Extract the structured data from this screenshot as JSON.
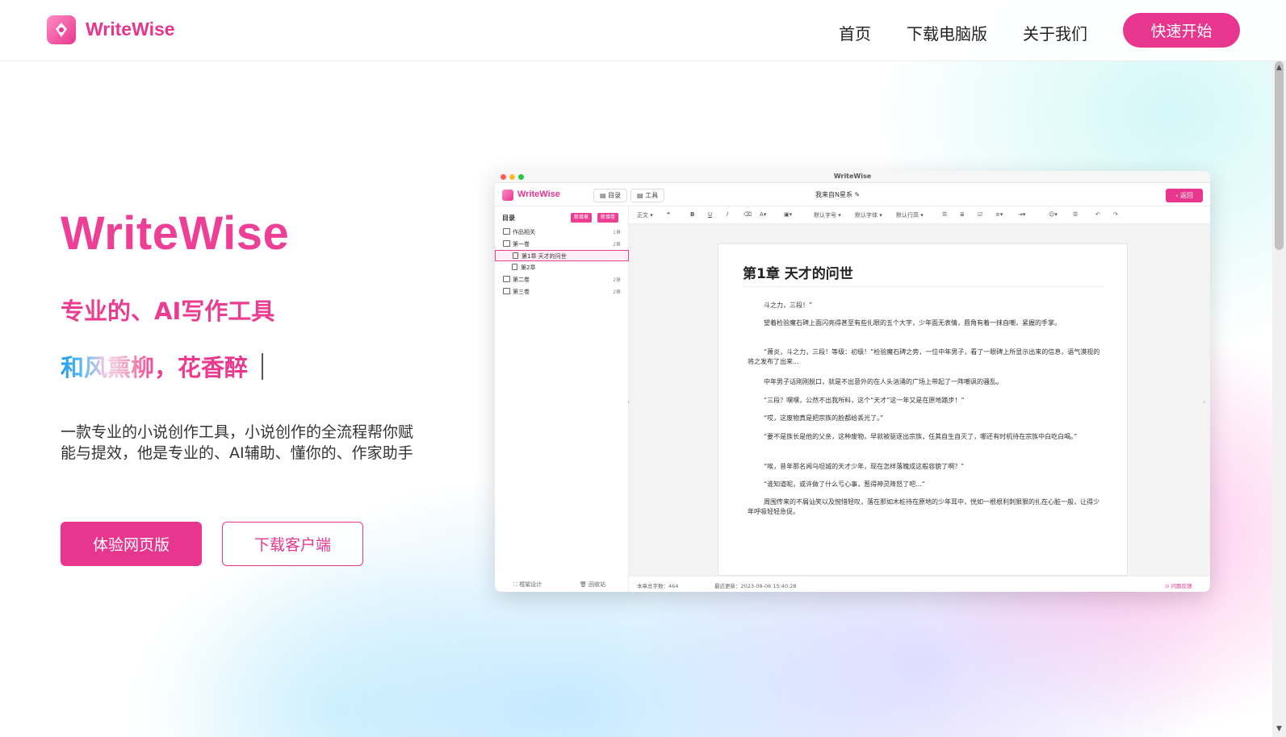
{
  "nav": {
    "brand": "WriteWise",
    "links": [
      "首页",
      "下载电脑版",
      "关于我们"
    ],
    "cta": "快速开始"
  },
  "hero": {
    "title": "WriteWise",
    "subtitle": "专业的、AI写作工具",
    "poem": "和风熏柳，花香醉",
    "description": "一款专业的小说创作工具，小说创作的全流程帮你赋能与提效，他是专业的、AI辅助、懂你的、作家助手",
    "btn_primary": "体验网页版",
    "btn_secondary": "下载客户端"
  },
  "app": {
    "window_title": "WriteWise",
    "brand": "WriteWise",
    "header_buttons": [
      "目录",
      "工具"
    ],
    "doc_name": "我来自N星系",
    "back_label": "返回",
    "sidebar": {
      "heading": "目录",
      "tag_new_chapter": "新增章",
      "tag_new_volume": "新增卷",
      "tree": [
        {
          "label": "作品相关",
          "count": "1章"
        },
        {
          "label": "第一卷",
          "count": "2章"
        },
        {
          "label": "第1章 天才的问世",
          "count": ""
        },
        {
          "label": "第2章",
          "count": ""
        },
        {
          "label": "第二卷",
          "count": "2章"
        },
        {
          "label": "第三卷",
          "count": "2章"
        }
      ],
      "footer_left": "框架设计",
      "footer_right": "回收站"
    },
    "toolbar": {
      "style": "正文",
      "font_size": "默认字号",
      "font_family": "默认字体",
      "line_height": "默认行高"
    },
    "chapter_title": "第1章  天才的问世",
    "paragraphs": [
      "斗之力，三段！”",
      "望着检验魔石碑上面闪亮得甚至有些扎眼的五个大字，少年面无表情，唇角有着一抹自嘲，紧握的手掌。",
      "“萧炎，斗之力，三段！等级：初级！”检验魔石碑之旁，一位中年男子，看了一眼碑上所显示出来的信息，语气漠视的将之发布了出来...",
      "中年男子话刚刚脱口，就是不出意外的在人头汹涌的广场上带起了一阵嘲讽的骚乱。",
      "“三段？嘿嘿，公然不出我所料，这个“天才”这一年又是在原地踏步！”",
      "“哎，这废物真是把宗族的脸都给丢光了。”",
      "“要不是族长是他的父亲，这种废物，早就被驱逐出宗族，任其自生自灭了，哪还有时机待在宗族中白吃白喝。”",
      "“唉，昔年那名闻乌坦城的天才少年，现在怎样落魄成这般容貌了啊？”",
      "“谁知道呢，或许做了什么亏心事，惹得神灵降怒了吧...”",
      "周围传来的不屑讪笑以及惋惜轻叹，落在那如木桩待在原地的少年耳中，恍如一根根利刺狠狠的扎在心脏一般，让得少年呼吸轻轻急促。"
    ],
    "status": {
      "word_count": "本章总字数：464",
      "last_update": "最近更新：2023-09-06 15:40:28",
      "feedback": "问题反馈"
    }
  },
  "colors": {
    "accent": "#e8368f"
  }
}
